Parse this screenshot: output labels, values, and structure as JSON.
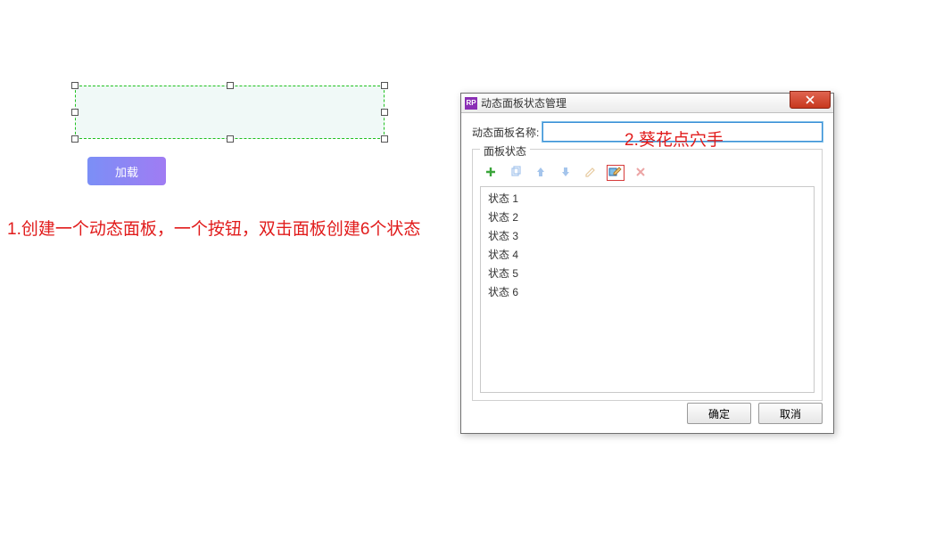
{
  "canvas": {
    "load_button_label": "加载"
  },
  "annotations": {
    "step1": "1.创建一个动态面板，一个按钮，双击面板创建6个状态",
    "step2": "2.葵花点穴手"
  },
  "dialog": {
    "rp_icon_text": "RP",
    "title": "动态面板状态管理",
    "name_label": "动态面板名称:",
    "name_value": "",
    "states_legend": "面板状态",
    "toolbar": {
      "add_icon": "add-icon",
      "duplicate_icon": "duplicate-icon",
      "move_up_icon": "arrow-up-icon",
      "move_down_icon": "arrow-down-icon",
      "edit_icon": "pencil-icon",
      "edit_all_icon": "edit-all-icon",
      "delete_icon": "delete-icon"
    },
    "states": [
      {
        "label": "状态 1"
      },
      {
        "label": "状态 2"
      },
      {
        "label": "状态 3"
      },
      {
        "label": "状态 4"
      },
      {
        "label": "状态 5"
      },
      {
        "label": "状态 6"
      }
    ],
    "ok_label": "确定",
    "cancel_label": "取消"
  }
}
